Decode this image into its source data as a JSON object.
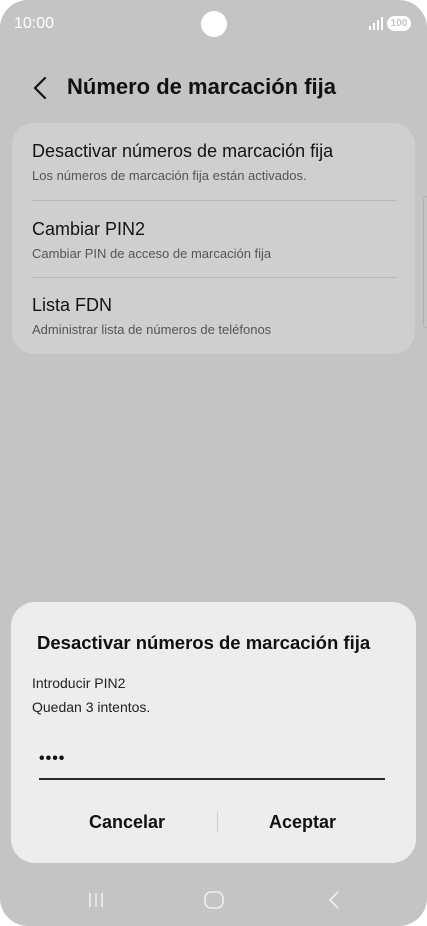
{
  "status_bar": {
    "time": "10:00",
    "battery": "100"
  },
  "header": {
    "title": "Número de marcación fija"
  },
  "settings": {
    "items": [
      {
        "title": "Desactivar números de marcación fija",
        "subtitle": "Los números de marcación fija están activados."
      },
      {
        "title": "Cambiar PIN2",
        "subtitle": "Cambiar PIN de acceso de marcación fija"
      },
      {
        "title": "Lista FDN",
        "subtitle": "Administrar lista de números de teléfonos"
      }
    ]
  },
  "dialog": {
    "title": "Desactivar números de marcación fija",
    "prompt": "Introducir PIN2",
    "attempts": "Quedan 3 intentos.",
    "pin_value": "••••",
    "cancel_label": "Cancelar",
    "accept_label": "Aceptar"
  },
  "nav_icons": [
    "recents-icon",
    "home-icon",
    "back-icon"
  ],
  "colors": {
    "dimmed_background": "#c4c4c4",
    "card": "#cfcfcf",
    "dialog": "#ededed",
    "text": "#111111"
  }
}
